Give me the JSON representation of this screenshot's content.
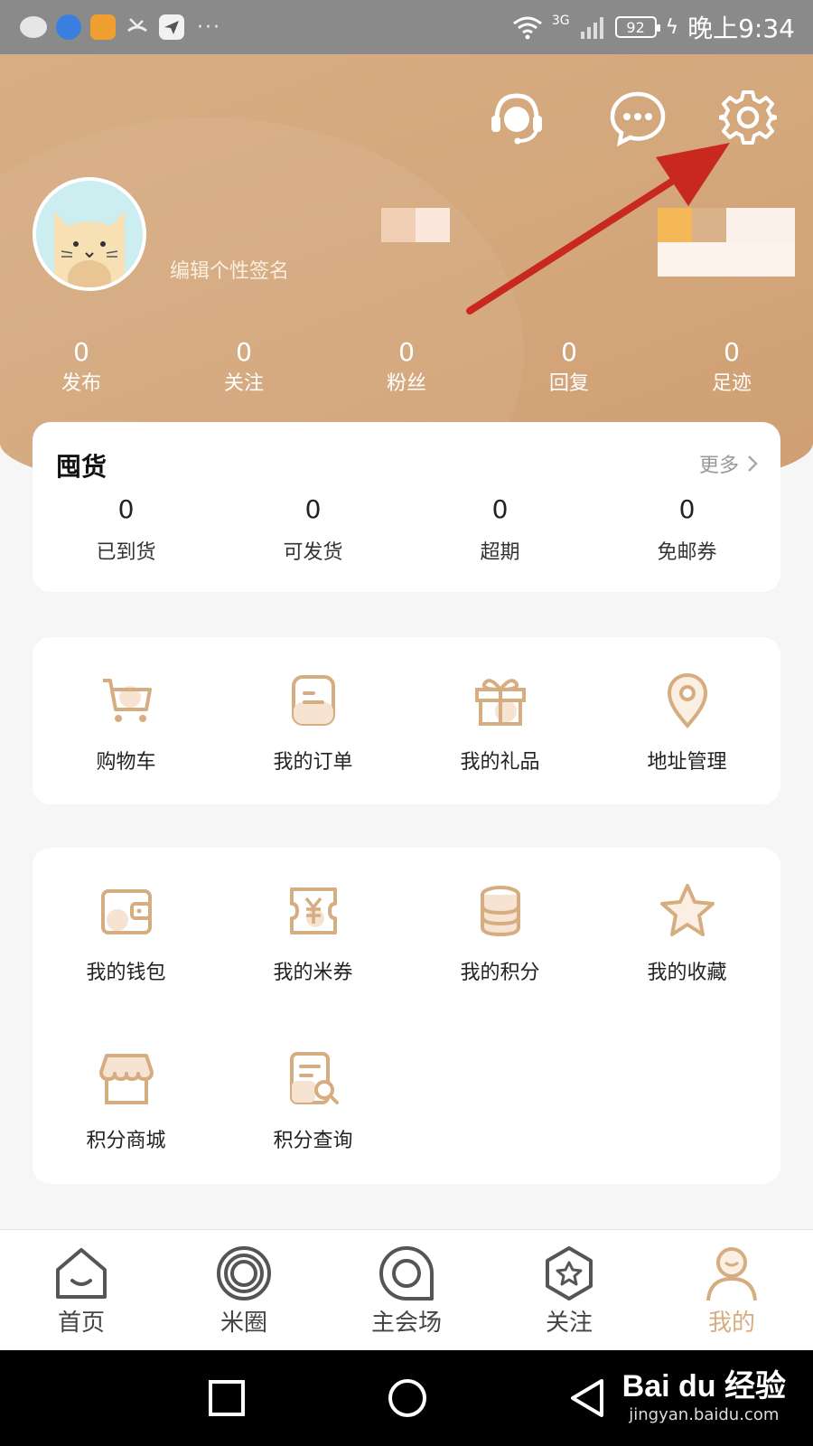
{
  "status_bar": {
    "time": "晚上9:34",
    "battery": "92",
    "network": "3G",
    "more": "···"
  },
  "header": {
    "signature": "编辑个性签名",
    "icons": [
      "customer-service-icon",
      "message-icon",
      "settings-icon"
    ],
    "stats": [
      {
        "value": "0",
        "label": "发布"
      },
      {
        "value": "0",
        "label": "关注"
      },
      {
        "value": "0",
        "label": "粉丝"
      },
      {
        "value": "0",
        "label": "回复"
      },
      {
        "value": "0",
        "label": "足迹"
      }
    ]
  },
  "hoard": {
    "title": "囤货",
    "more": "更多",
    "items": [
      {
        "value": "0",
        "label": "已到货"
      },
      {
        "value": "0",
        "label": "可发货"
      },
      {
        "value": "0",
        "label": "超期"
      },
      {
        "value": "0",
        "label": "免邮券"
      }
    ]
  },
  "services": {
    "items": [
      {
        "label": "购物车",
        "icon": "cart-icon"
      },
      {
        "label": "我的订单",
        "icon": "order-icon"
      },
      {
        "label": "我的礼品",
        "icon": "gift-icon"
      },
      {
        "label": "地址管理",
        "icon": "location-icon"
      }
    ]
  },
  "assets": {
    "items": [
      {
        "label": "我的钱包",
        "icon": "wallet-icon"
      },
      {
        "label": "我的米券",
        "icon": "coupon-icon"
      },
      {
        "label": "我的积分",
        "icon": "coins-icon"
      },
      {
        "label": "我的收藏",
        "icon": "star-icon"
      },
      {
        "label": "积分商城",
        "icon": "store-icon"
      },
      {
        "label": "积分查询",
        "icon": "points-query-icon"
      }
    ]
  },
  "tabbar": {
    "tabs": [
      {
        "label": "首页",
        "icon": "home-icon"
      },
      {
        "label": "米圈",
        "icon": "circle-icon"
      },
      {
        "label": "主会场",
        "icon": "venue-icon"
      },
      {
        "label": "关注",
        "icon": "follow-icon"
      },
      {
        "label": "我的",
        "icon": "profile-icon",
        "active": true
      }
    ]
  },
  "watermark": {
    "brand": "Bai du 经验",
    "url": "jingyan.baidu.com"
  },
  "colors": {
    "accent": "#d6ad80",
    "header_bg": "#d3a57a",
    "arrow": "#c8281e"
  }
}
